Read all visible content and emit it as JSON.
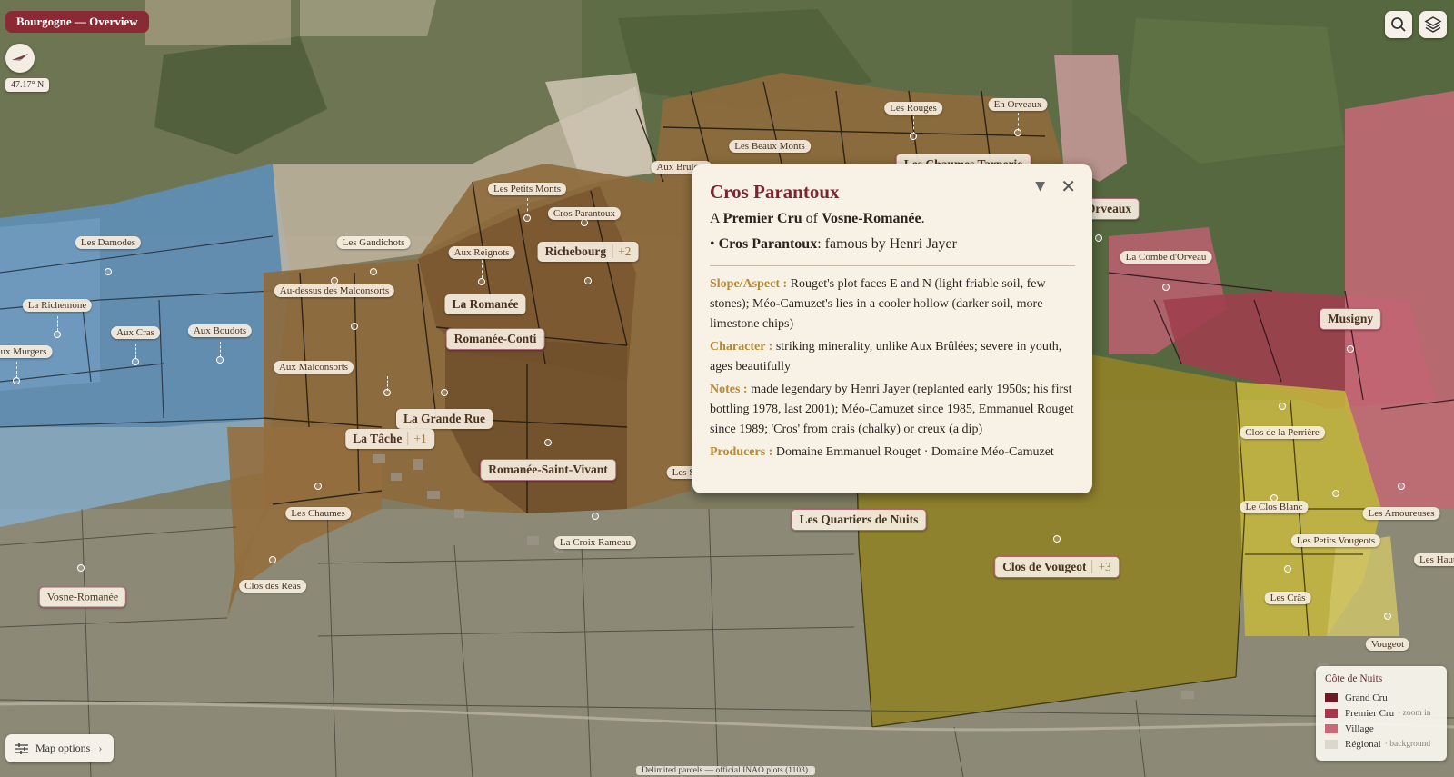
{
  "header": {
    "title": "Bourgogne — Overview",
    "latitude": "47.17° N"
  },
  "toolbar": {
    "search_icon": "search-icon",
    "layers_icon": "layers-icon"
  },
  "map": {
    "labels": {
      "les_rouges": "Les Rouges",
      "en_orveaux": "En Orveaux",
      "les_beaux_monts": "Les Beaux Monts",
      "aux_brulees": "Aux Brulées",
      "les_chaumes_tarperie_partial": "Les Chaumes Tarperie",
      "en_orveaux_partial": "Orveaux",
      "les_petits_monts": "Les Petits Monts",
      "cros_parantoux": "Cros Parantoux",
      "les_damodes": "Les Damodes",
      "les_gaudichots": "Les Gaudichots",
      "aux_reignots": "Aux Reignots",
      "richebourg": "Richebourg",
      "richebourg_count": "+2",
      "la_combe_dorveau": "La Combe d'Orveau",
      "au_dessus_des_malconsorts": "Au-dessus des Malconsorts",
      "la_richemone": "La Richemone",
      "la_romanee": "La Romanée",
      "musigny": "Musigny",
      "aux_cras": "Aux Cras",
      "aux_boudots": "Aux Boudots",
      "romanee_conti": "Romanée-Conti",
      "aux_murgers": "Aux Murgers",
      "aux_malconsorts": "Aux Malconsorts",
      "la_grande_rue": "La Grande Rue",
      "la_tache": "La Tâche",
      "la_tache_count": "+1",
      "clos_de_la_perriere": "Clos de la Perrière",
      "romanee_saint_vivant": "Romanée-Saint-Vivant",
      "les_suchots_partial": "Les S",
      "les_chaumes": "Les Chaumes",
      "le_clos_blanc": "Le Clos Blanc",
      "les_amoureuses": "Les Amoureuses",
      "les_quartiers_de_nuits": "Les Quartiers de Nuits",
      "la_croix_rameau": "La Croix Rameau",
      "les_petits_vougeots": "Les Petits Vougeots",
      "clos_de_vougeot": "Clos de Vougeot",
      "clos_de_vougeot_count": "+3",
      "les_hauts_partial": "Les Haut",
      "clos_des_reas": "Clos des Réas",
      "vosne_romanee": "Vosne-Romanée",
      "les_cras": "Les Crâs",
      "vougeot": "Vougeot"
    }
  },
  "popup": {
    "title": "Cros Parantoux",
    "sub_prefix": "A ",
    "sub_rank": "Premier Cru",
    "sub_mid": " of ",
    "sub_village": "Vosne-Romanée",
    "sub_suffix": ".",
    "bullet_mark": "• ",
    "bullet_name": "Cros Parantoux",
    "bullet_text": ": famous by Henri Jayer",
    "rows": [
      {
        "key": "Slope/Aspect :",
        "text": " Rouget's plot faces E and N (light friable soil, few stones); Méo-Camuzet's lies in a cooler hollow (darker soil, more limestone chips)"
      },
      {
        "key": "Character :",
        "text": " striking minerality, unlike Aux Brûlées; severe in youth, ages beautifully"
      },
      {
        "key": "Notes :",
        "text": " made legendary by Henri Jayer (replanted early 1950s; his first bottling 1978, last 2001); Méo-Camuzet since 1985, Emmanuel Rouget since 1989; 'Cros' from crais (chalky) or creux (a dip)"
      },
      {
        "key": "Producers :",
        "text": " Domaine Emmanuel Rouget · Domaine Méo-Camuzet"
      }
    ],
    "collapse_glyph": "▼",
    "close_glyph": "✕"
  },
  "legend": {
    "title": "Côte de Nuits",
    "items": [
      {
        "label": "Grand Cru",
        "color": "#6e1a24",
        "note": ""
      },
      {
        "label": "Premier Cru",
        "color": "#a8354a",
        "note": "· zoom in"
      },
      {
        "label": "Village",
        "color": "#c96875",
        "note": ""
      },
      {
        "label": "Régional",
        "color": "#dcd6cc",
        "note": "· background"
      }
    ]
  },
  "map_options": {
    "label": "Map options",
    "icon": "sliders-icon",
    "chevron": "›"
  },
  "footer": {
    "text": "Delimited parcels — official INAO plots (1103)."
  }
}
